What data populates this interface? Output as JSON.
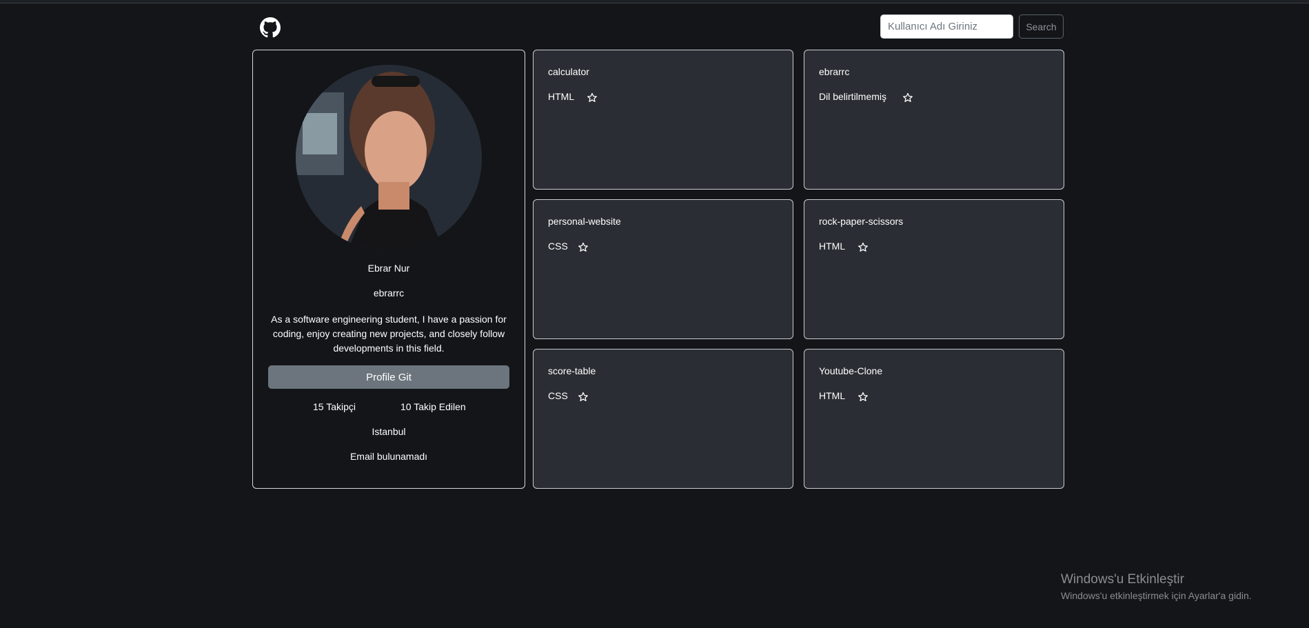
{
  "header": {
    "logo_icon": "github-icon",
    "search_placeholder": "Kullanıcı Adı Giriniz",
    "search_button": "Search"
  },
  "profile": {
    "avatar_icon": "profile-photo",
    "name": "Ebrar Nur",
    "login": "ebrarrc",
    "bio": "As a software engineering student, I have a passion for coding, enjoy creating new projects, and closely follow developments in this field.",
    "profile_button": "Profile Git",
    "followers": "15 Takipçi",
    "following": "10 Takip Edilen",
    "location": "Istanbul",
    "email": "Email bulunamadı"
  },
  "repos": [
    {
      "name": "calculator",
      "language": "HTML"
    },
    {
      "name": "ebrarrc",
      "language": "Dil belirtilmemiş"
    },
    {
      "name": "personal-website",
      "language": "CSS"
    },
    {
      "name": "rock-paper-scissors",
      "language": "HTML"
    },
    {
      "name": "score-table",
      "language": "CSS"
    },
    {
      "name": "Youtube-Clone",
      "language": "HTML"
    }
  ],
  "watermark": {
    "title": "Windows'u Etkinleştir",
    "subtitle": "Windows'u etkinleştirmek için Ayarlar'a gidin."
  },
  "colors": {
    "background": "#131519",
    "card": "#2a2d33",
    "button": "#6c757d"
  }
}
